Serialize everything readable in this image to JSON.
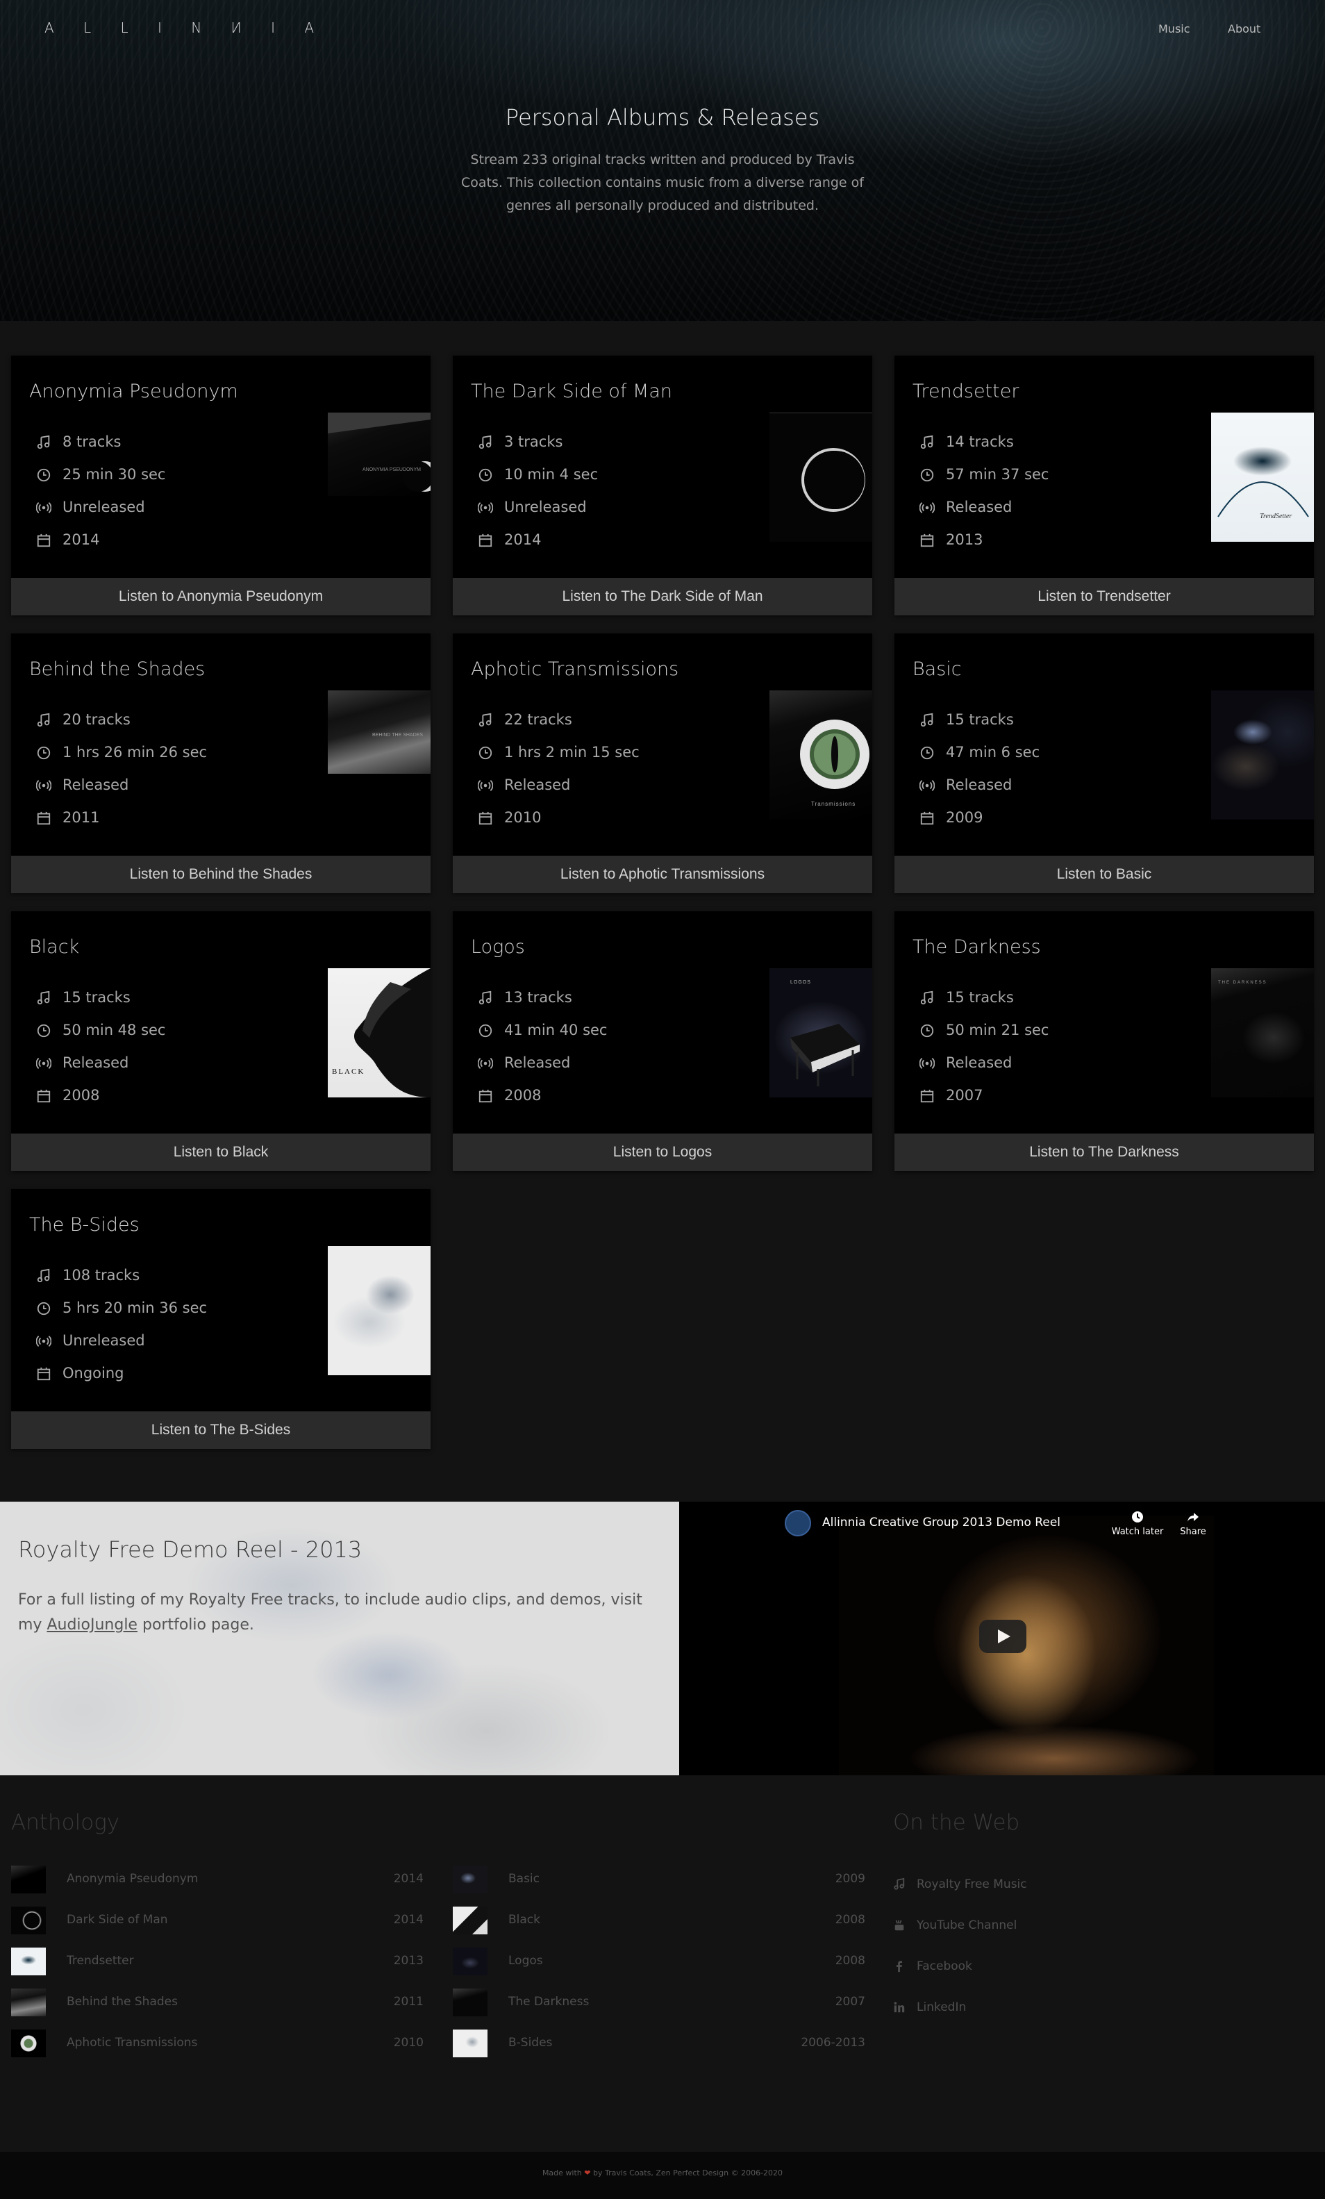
{
  "header": {
    "logo": "A L L I N И I A",
    "nav": [
      {
        "label": "Music"
      },
      {
        "label": "About"
      }
    ]
  },
  "hero": {
    "title": "Personal Albums & Releases",
    "description": "Stream 233 original tracks written and produced by Travis Coats. This collection contains music from a diverse range of genres all personally produced and distributed."
  },
  "albums": [
    {
      "title": "Anonymia Pseudonym",
      "tracks": "8 tracks",
      "duration": "25 min 30 sec",
      "status": "Unreleased",
      "year": "2014",
      "listen": "Listen to Anonymia Pseudonym",
      "cover_text": "ANONYMIA PSEUDONYM"
    },
    {
      "title": "The Dark Side of Man",
      "tracks": "3 tracks",
      "duration": "10 min 4 sec",
      "status": "Unreleased",
      "year": "2014",
      "listen": "Listen to The Dark Side of Man",
      "cover_text": ""
    },
    {
      "title": "Trendsetter",
      "tracks": "14 tracks",
      "duration": "57 min 37 sec",
      "status": "Released",
      "year": "2013",
      "listen": "Listen to Trendsetter",
      "cover_text": "TrendSetter"
    },
    {
      "title": "Behind the Shades",
      "tracks": "20 tracks",
      "duration": "1 hrs 26 min 26 sec",
      "status": "Released",
      "year": "2011",
      "listen": "Listen to Behind the Shades",
      "cover_text": "BEHIND THE SHADES"
    },
    {
      "title": "Aphotic Transmissions",
      "tracks": "22 tracks",
      "duration": "1 hrs 2 min 15 sec",
      "status": "Released",
      "year": "2010",
      "listen": "Listen to Aphotic Transmissions",
      "cover_text": "Transmissions"
    },
    {
      "title": "Basic",
      "tracks": "15 tracks",
      "duration": "47 min 6 sec",
      "status": "Released",
      "year": "2009",
      "listen": "Listen to Basic",
      "cover_text": ""
    },
    {
      "title": "Black",
      "tracks": "15 tracks",
      "duration": "50 min 48 sec",
      "status": "Released",
      "year": "2008",
      "listen": "Listen to Black",
      "cover_text": "BLACK"
    },
    {
      "title": "Logos",
      "tracks": "13 tracks",
      "duration": "41 min 40 sec",
      "status": "Released",
      "year": "2008",
      "listen": "Listen to Logos",
      "cover_text": "LOGOS"
    },
    {
      "title": "The Darkness",
      "tracks": "15 tracks",
      "duration": "50 min 21 sec",
      "status": "Released",
      "year": "2007",
      "listen": "Listen to The Darkness",
      "cover_text": "THE DARKNESS"
    },
    {
      "title": "The B-Sides",
      "tracks": "108 tracks",
      "duration": "5 hrs 20 min 36 sec",
      "status": "Unreleased",
      "year": "Ongoing",
      "listen": "Listen to The B-Sides",
      "cover_text": ""
    }
  ],
  "demo": {
    "title": "Royalty Free Demo Reel - 2013",
    "text_before": "For a full listing of my Royalty Free tracks, to include audio clips, and demos, visit my ",
    "link": "AudioJungle",
    "text_after": " portfolio page."
  },
  "video": {
    "title": "Allinnia Creative Group 2013 Demo Reel",
    "watch_later": "Watch later",
    "share": "Share"
  },
  "anthology": {
    "heading": "Anthology",
    "items": [
      {
        "name": "Anonymia Pseudonym",
        "year": "2014"
      },
      {
        "name": "Dark Side of Man",
        "year": "2014"
      },
      {
        "name": "Trendsetter",
        "year": "2013"
      },
      {
        "name": "Behind the Shades",
        "year": "2011"
      },
      {
        "name": "Aphotic Transmissions",
        "year": "2010"
      },
      {
        "name": "Basic",
        "year": "2009"
      },
      {
        "name": "Black",
        "year": "2008"
      },
      {
        "name": "Logos",
        "year": "2008"
      },
      {
        "name": "The Darkness",
        "year": "2007"
      },
      {
        "name": "B-Sides",
        "year": "2006-2013"
      }
    ]
  },
  "web": {
    "heading": "On the Web",
    "links": [
      {
        "label": "Royalty Free Music",
        "icon": "music-note-icon"
      },
      {
        "label": "YouTube Channel",
        "icon": "youtube-icon"
      },
      {
        "label": "Facebook",
        "icon": "facebook-icon"
      },
      {
        "label": "LinkedIn",
        "icon": "linkedin-icon"
      }
    ]
  },
  "footer": {
    "made_with": "Made with",
    "heart": "❤",
    "credit": "by Travis Coats, Zen Perfect Design © 2006-2020"
  }
}
